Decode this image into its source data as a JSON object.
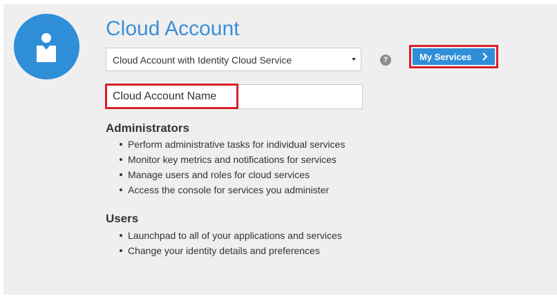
{
  "title": "Cloud Account",
  "account_select": {
    "selected": "Cloud Account with Identity Cloud Service"
  },
  "help_icon": {
    "glyph": "?"
  },
  "services_button": {
    "label": "My Services"
  },
  "account_name": {
    "placeholder": "Cloud Account Name",
    "value": ""
  },
  "administrators": {
    "heading": "Administrators",
    "items": [
      "Perform administrative tasks for individual services",
      "Monitor key metrics and notifications for services",
      "Manage users and roles for cloud services",
      "Access the console for services you administer"
    ]
  },
  "users": {
    "heading": "Users",
    "items": [
      "Launchpad to all of your applications and services",
      "Change your identity details and preferences"
    ]
  },
  "colors": {
    "accent": "#2f8ed8",
    "title": "#3b8fd6",
    "highlight": "#d6202a",
    "panel": "#efeff0"
  }
}
